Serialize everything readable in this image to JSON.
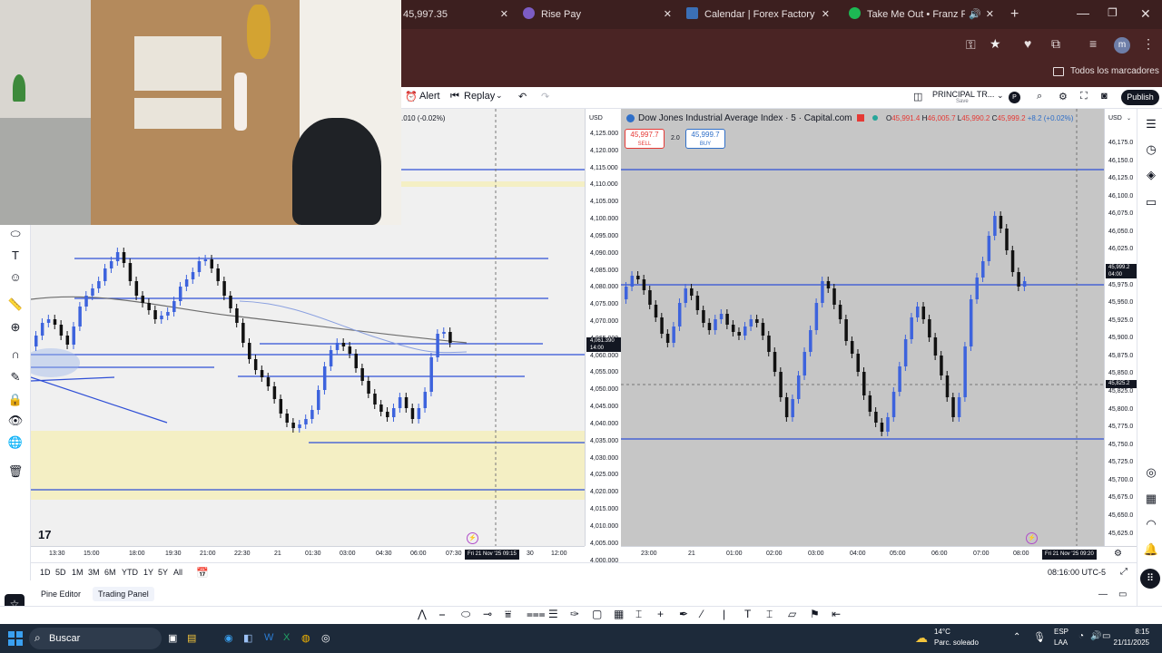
{
  "browser": {
    "tabs": [
      {
        "label": "45,997.35",
        "color": "#5b2a2a"
      },
      {
        "label": "Rise Pay",
        "color": "#7c5cc4"
      },
      {
        "label": "Calendar | Forex Factory",
        "color": "#3b6fb6"
      },
      {
        "label": "Take Me Out • Franz Ferdi",
        "color": "#1db954"
      }
    ],
    "new_tab_label": "+",
    "bookmarks_label": "Todos los marcadores",
    "profile_initial": "m"
  },
  "toolbar": {
    "alert_label": "Alert",
    "replay_label": "Replay",
    "layout_name": "PRINCIPAL TR...",
    "layout_sub": "Save",
    "publish_label": "Publish"
  },
  "left_chart": {
    "currency": "USD",
    "change_readout": ".010 (-0.02%)",
    "price_ticks": [
      "4,125.000",
      "4,120.000",
      "4,115.000",
      "4,110.000",
      "4,105.000",
      "4,100.000",
      "4,095.000",
      "4,090.000",
      "4,085.000",
      "4,080.000",
      "4,075.000",
      "4,070.000",
      "4,065.000",
      "4,060.000",
      "4,055.000",
      "4,050.000",
      "4,045.000",
      "4,040.000",
      "4,035.000",
      "4,030.000",
      "4,025.000",
      "4,020.000",
      "4,015.000",
      "4,010.000",
      "4,005.000",
      "4,000.000"
    ],
    "current_price_label": "4,061.390",
    "current_price_time": "14:00",
    "time_ticks": [
      "13:30",
      "15:00",
      "18:00",
      "19:30",
      "21:00",
      "22:30",
      "21",
      "01:30",
      "03:00",
      "04:30",
      "06:00",
      "07:30",
      "12:00"
    ],
    "crosshair_time": "Fri 21 Nov '25   09:15",
    "trailing_tick": "30"
  },
  "right_chart": {
    "title": "Dow Jones Industrial Average Index · 5 · Capital.com",
    "ohlc": {
      "o_label": "O",
      "o": "45,991.4",
      "h_label": "H",
      "h": "46,005.7",
      "l_label": "L",
      "l": "45,990.2",
      "c_label": "C",
      "c": "45,999.2",
      "chg": "+8.2 (+0.02%)"
    },
    "sell_price": "45,997.7",
    "sell_label": "SELL",
    "spread": "2.0",
    "buy_price": "45,999.7",
    "buy_label": "BUY",
    "currency": "USD",
    "price_ticks": [
      "46,175.0",
      "46,150.0",
      "46,125.0",
      "46,100.0",
      "46,075.0",
      "46,050.0",
      "46,025.0",
      "46,000.0",
      "45,975.0",
      "45,950.0",
      "45,925.0",
      "45,900.0",
      "45,875.0",
      "45,850.0",
      "45,825.0",
      "45,800.0",
      "45,775.0",
      "45,750.0",
      "45,725.0",
      "45,700.0",
      "45,675.0",
      "45,650.0",
      "45,625.0"
    ],
    "current_price_label": "45,999.2",
    "current_price_time": "04:00",
    "crosshair_price_label": "45,825.2",
    "time_ticks": [
      "23:00",
      "21",
      "01:00",
      "02:00",
      "03:00",
      "04:00",
      "05:00",
      "06:00",
      "07:00",
      "08:00"
    ],
    "crosshair_time": "Fri 21 Nov '25   09:20"
  },
  "range_bar": {
    "ranges": [
      "1D",
      "5D",
      "1M",
      "3M",
      "6M",
      "YTD",
      "1Y",
      "5Y",
      "All"
    ],
    "clock": "08:16:00 UTC-5"
  },
  "panels": {
    "pine_editor": "Pine Editor",
    "trading_panel": "Trading Panel"
  },
  "taskbar": {
    "search_placeholder": "Buscar",
    "weather_temp": "14°C",
    "weather_desc": "Parc. soleado",
    "lang_top": "ESP",
    "lang_bottom": "LAA",
    "time": "8:15",
    "date": "21/11/2025"
  },
  "colors": {
    "bull": "#3d63dd",
    "bear": "#111111",
    "hline": "#2f4fd6",
    "zone": "#f4efc4",
    "chart_bg": "#f0f0f0"
  }
}
